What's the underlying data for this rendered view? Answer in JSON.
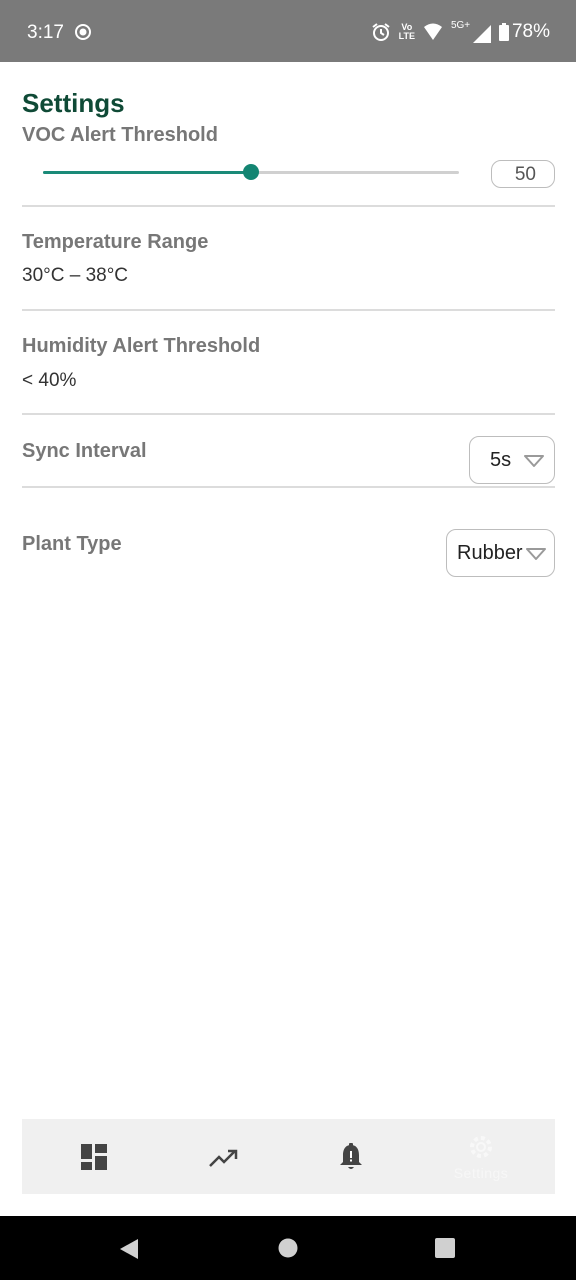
{
  "status_bar": {
    "time": "3:17",
    "network_label_top": "Vo",
    "network_label_bottom": "LTE",
    "signal_label": "5G+",
    "battery": "78%"
  },
  "page": {
    "title": "Settings"
  },
  "voc": {
    "label": "VOC Alert Threshold",
    "value": "50",
    "slider_fraction": 0.5
  },
  "temperature": {
    "label": "Temperature Range",
    "value": "30°C – 38°C"
  },
  "humidity": {
    "label": "Humidity Alert Threshold",
    "value": "< 40%"
  },
  "sync": {
    "label": "Sync Interval",
    "selected": "5s"
  },
  "plant": {
    "label": "Plant Type",
    "selected": "Rubber"
  },
  "bottom_nav": {
    "items": [
      {
        "icon": "dashboard-icon"
      },
      {
        "icon": "trending-up-icon"
      },
      {
        "icon": "bell-alert-icon"
      },
      {
        "icon": "gear-icon",
        "label": "Settings"
      }
    ]
  },
  "colors": {
    "accent": "#138572",
    "title": "#0f4a36",
    "status_bar": "#7a7a7a"
  }
}
